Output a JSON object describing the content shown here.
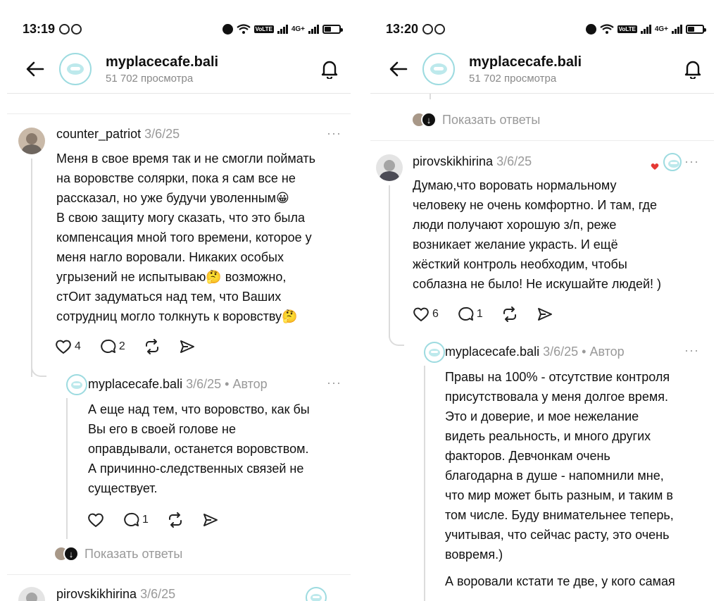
{
  "left": {
    "status": {
      "time": "13:19",
      "net": "4G+"
    },
    "header": {
      "account": "myplacecafe.bali",
      "views": "51 702 просмотра"
    },
    "comment1": {
      "username": "counter_patriot",
      "date": "3/6/25",
      "text": "Меня в свое время так и не смогли поймать\nна воровстве солярки, пока я сам все не\nрассказал, но уже будучи уволенным😀\nВ свою защиту могу сказать, что это была\nкомпенсация мной того времени, которое у\nменя нагло воровали. Никаких особых\nугрызений не испытываю🤔 возможно,\nстОит задуматься над тем, что Ваших\nсотрудниц могло толкнуть к воровству🤔",
      "likes": "4",
      "replies": "2"
    },
    "reply1": {
      "username": "myplacecafe.bali",
      "date": "3/6/25",
      "author_tag": "• Автор",
      "text": "А еще над тем, что воровство, как бы\nВы его в своей голове не\nоправдывали, останется воровством.\nА причинно-следственных связей не\nсуществует.",
      "likes": "",
      "replies": "1"
    },
    "show_replies": "Показать ответы",
    "next_username": "pirovskikhirina",
    "next_date": "3/6/25"
  },
  "right": {
    "status": {
      "time": "13:20",
      "net": "4G+"
    },
    "header": {
      "account": "myplacecafe.bali",
      "views": "51 702 просмотра"
    },
    "show_replies": "Показать ответы",
    "comment1": {
      "username": "pirovskikhirina",
      "date": "3/6/25",
      "text": "Думаю,что воровать нормальному\nчеловеку не очень комфортно. И там, где\nлюди получают хорошую з/п, реже\nвозникает желание украсть. И ещё\nжёсткий контроль необходим, чтобы\nсоблазна не было! Не искушайте людей! )",
      "likes": "6",
      "replies": "1"
    },
    "reply1": {
      "username": "myplacecafe.bali",
      "date": "3/6/25",
      "author_tag": "• Автор",
      "text": "Правы на 100% - отсутствие контроля\nприсутствовала у меня долгое время.\nЭто и доверие, и мое нежелание\nвидеть реальность, и много других\nфакторов. Девчонкам очень\nблагодарна в душе - напомнили мне,\nчто мир может быть разным, и таким в\nтом числе. Буду внимательнее теперь,\nучитывая, что сейчас расту, это очень\nвовремя.)",
      "text2": "А воровали кстати те две, у кого самая"
    }
  },
  "colors": {
    "accent_logo": "#9ddbe0",
    "muted": "#999999",
    "text": "#111111"
  }
}
